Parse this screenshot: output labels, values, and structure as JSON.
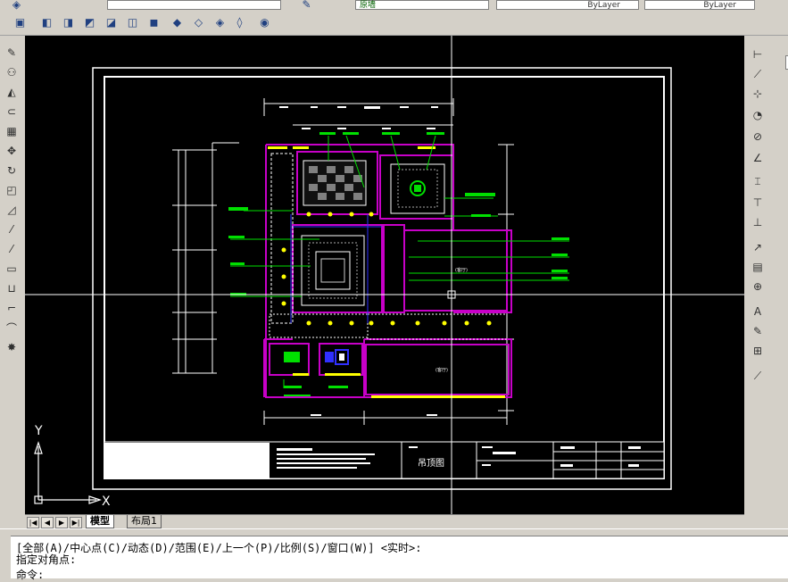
{
  "layers": {
    "layer_name": "原墙",
    "color_value": "ByLayer",
    "linetype_value": "ByLayer"
  },
  "drawing": {
    "title_block_label": "吊顶图",
    "axis_y": "Y",
    "axis_x": "X",
    "room_label": "(客厅)"
  },
  "tabs": [
    {
      "label": "模型",
      "active": true
    },
    {
      "label": "布局1",
      "active": false
    }
  ],
  "command": {
    "line1": "[全部(A)/中心点(C)/动态(D)/范围(E)/上一个(P)/比例(S)/窗口(W)] <实时>:",
    "line2": "指定对角点:",
    "line3": "命令:"
  },
  "colors": {
    "canvas": "#000000",
    "magenta": "#c800c8",
    "green": "#00e000",
    "blue": "#3030ff",
    "yellow": "#ffff00",
    "white": "#ffffff"
  }
}
